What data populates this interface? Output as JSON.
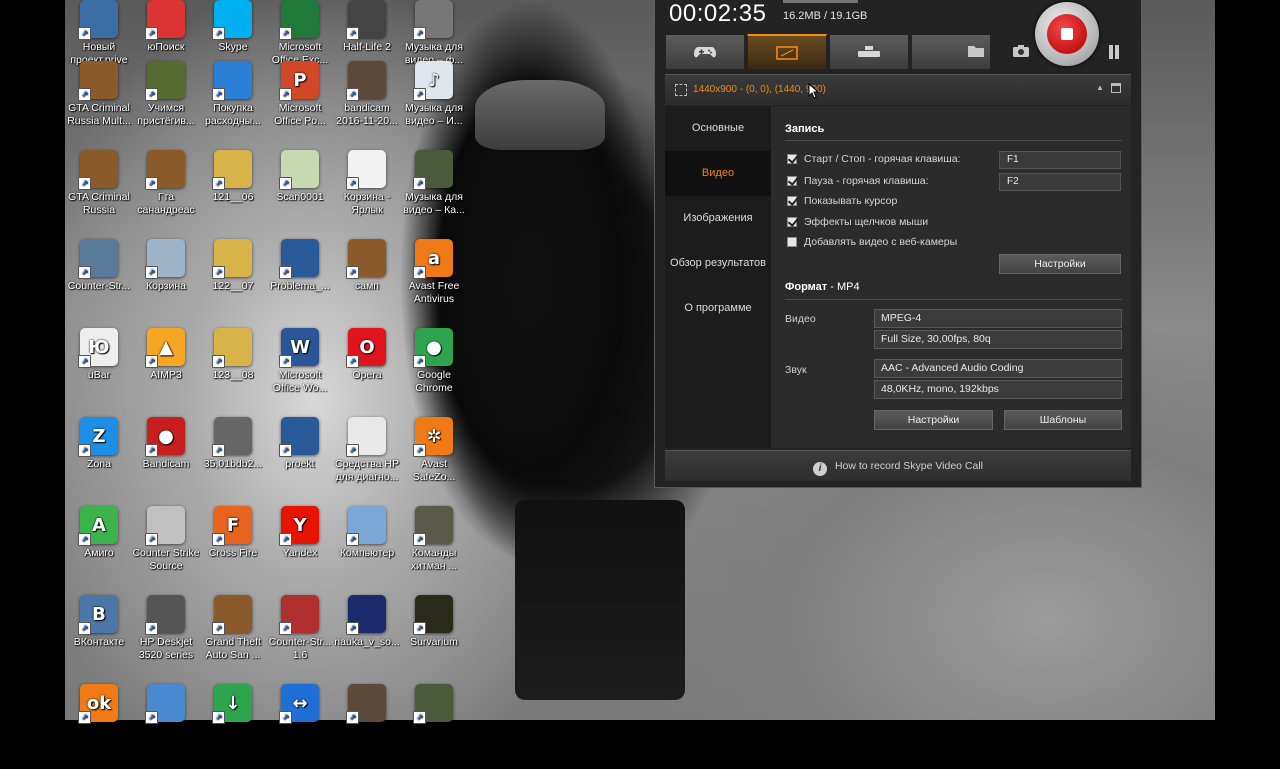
{
  "desktop": {
    "icons": [
      {
        "label": "Новый проект.prjve",
        "glyph": "",
        "color": "#3a6ea5"
      },
      {
        "label": "юПоиск",
        "glyph": "",
        "color": "#d33"
      },
      {
        "label": "Skype",
        "glyph": "",
        "color": "#00aff0"
      },
      {
        "label": "Microsoft Office Exc...",
        "glyph": "",
        "color": "#1f7a3a"
      },
      {
        "label": "Half-Life 2",
        "glyph": "",
        "color": "#444"
      },
      {
        "label": "Музыка для видео – ф...",
        "glyph": "",
        "color": "#777"
      },
      {
        "label": "GTA Criminal Russia Mult...",
        "glyph": "",
        "color": "#8a5a2a"
      },
      {
        "label": "Учимся пристёгив...",
        "glyph": "",
        "color": "#556b2f"
      },
      {
        "label": "Покупка расходны...",
        "glyph": "",
        "color": "#2a7fd4"
      },
      {
        "label": "Microsoft Office Po...",
        "glyph": "P",
        "color": "#d24726"
      },
      {
        "label": "bandicam 2016-11-20...",
        "glyph": "",
        "color": "#5b4a3a"
      },
      {
        "label": "Музыка для видео – И...",
        "glyph": "♪",
        "color": "#dfe6ee"
      },
      {
        "label": "GTA Criminal Russia",
        "glyph": "",
        "color": "#8a5a2a"
      },
      {
        "label": "Гта санандреас",
        "glyph": "",
        "color": "#8a5a2a"
      },
      {
        "label": "121__06",
        "glyph": "",
        "color": "#d8b34a"
      },
      {
        "label": "Scan0001",
        "glyph": "",
        "color": "#c8d8b0"
      },
      {
        "label": "Корзина - Ярлык",
        "glyph": "",
        "color": "#f2f2f2"
      },
      {
        "label": "Музыка для видео – Ка...",
        "glyph": "",
        "color": "#4a5a3a"
      },
      {
        "label": "Counter-Str...",
        "glyph": "",
        "color": "#5a7a9a"
      },
      {
        "label": "Корзина",
        "glyph": "",
        "color": "#9fb4c8"
      },
      {
        "label": "122__07",
        "glyph": "",
        "color": "#d8b34a"
      },
      {
        "label": "Problema_...",
        "glyph": "",
        "color": "#2a5a9a"
      },
      {
        "label": "самп",
        "glyph": "",
        "color": "#8a5a2a"
      },
      {
        "label": "Avast Free Antivirus",
        "glyph": "a",
        "color": "#f07a16"
      },
      {
        "label": "uBar",
        "glyph": "Ю",
        "color": "#eee"
      },
      {
        "label": "AIMP3",
        "glyph": "▲",
        "color": "#f5a623"
      },
      {
        "label": "123__08",
        "glyph": "",
        "color": "#d8b34a"
      },
      {
        "label": "Microsoft Office Wo...",
        "glyph": "W",
        "color": "#2b579a"
      },
      {
        "label": "Opera",
        "glyph": "O",
        "color": "#e0141e"
      },
      {
        "label": "Google Chrome",
        "glyph": "●",
        "color": "#2ea44f"
      },
      {
        "label": "Zona",
        "glyph": "Z",
        "color": "#1e8fe6"
      },
      {
        "label": "Bandicam",
        "glyph": "●",
        "color": "#c81e1e"
      },
      {
        "label": "35,01bdb2...",
        "glyph": "",
        "color": "#666"
      },
      {
        "label": "proekt",
        "glyph": "",
        "color": "#2a5a9a"
      },
      {
        "label": "Средства HP для диагно...",
        "glyph": "",
        "color": "#e8e8e8"
      },
      {
        "label": "Avast SafeZo...",
        "glyph": "✲",
        "color": "#f07a16"
      },
      {
        "label": "Амиго",
        "glyph": "A",
        "color": "#3cb34a"
      },
      {
        "label": "Counter Strike Source",
        "glyph": "",
        "color": "#c0c0c0"
      },
      {
        "label": "Cross Fire",
        "glyph": "F",
        "color": "#e8641e"
      },
      {
        "label": "Yandex",
        "glyph": "Y",
        "color": "#e61400"
      },
      {
        "label": "Компьютер",
        "glyph": "",
        "color": "#7aa7d6"
      },
      {
        "label": "Команды хитман ...",
        "glyph": "",
        "color": "#5a5a4a"
      },
      {
        "label": "ВКонтакте",
        "glyph": "B",
        "color": "#4a76a8"
      },
      {
        "label": "HP Deskjet 3520 series",
        "glyph": "",
        "color": "#555"
      },
      {
        "label": "Grand Theft Auto San ...",
        "glyph": "",
        "color": "#8a5a2a"
      },
      {
        "label": "Counter-Str... 1.6",
        "glyph": "",
        "color": "#b03030"
      },
      {
        "label": "nauka_v_so...",
        "glyph": "",
        "color": "#1a2a6a"
      },
      {
        "label": "Survarium",
        "glyph": "",
        "color": "#2a2a1a"
      },
      {
        "label": "",
        "glyph": "ok",
        "color": "#f07a16"
      },
      {
        "label": "",
        "glyph": "",
        "color": "#4a8ad0"
      },
      {
        "label": "",
        "glyph": "↓",
        "color": "#2ea44f"
      },
      {
        "label": "",
        "glyph": "↔",
        "color": "#1e6fd6"
      },
      {
        "label": "",
        "glyph": "",
        "color": "#5a4a3a"
      },
      {
        "label": "",
        "glyph": "",
        "color": "#4a5a3a"
      }
    ]
  },
  "recorder": {
    "timer": "00:02:35",
    "filesize": "16.2MB / 19.1GB",
    "region": "1440x900 - (0, 0), (1440, 900)",
    "nav": [
      "Основные",
      "Видео",
      "Изображения",
      "Обзор результатов",
      "О программе"
    ],
    "active_nav": 1,
    "record": {
      "heading": "Запись",
      "options": [
        {
          "label": "Старт / Стоп - горячая клавиша:",
          "checked": true
        },
        {
          "label": "Пауза - горячая клавиша:",
          "checked": true
        },
        {
          "label": "Показывать курсор",
          "checked": true
        },
        {
          "label": "Эффекты щелчков мыши",
          "checked": true
        },
        {
          "label": "Добавлять видео с веб-камеры",
          "checked": false
        }
      ],
      "hotkey_start": "F1",
      "hotkey_pause": "F2",
      "settings_label": "Настройки"
    },
    "format": {
      "heading": "Формат",
      "value": " - MP4",
      "video_label": "Видео",
      "video_codec": "MPEG-4",
      "video_params": "Full Size, 30,00fps, 80q",
      "audio_label": "Звук",
      "audio_codec": "AAC - Advanced Audio Coding",
      "audio_params": "48,0KHz, mono, 192kbps",
      "settings_label": "Настройки",
      "templates_label": "Шаблоны"
    },
    "footer": "How to record Skype Video Call",
    "accent": "#f08a16"
  }
}
